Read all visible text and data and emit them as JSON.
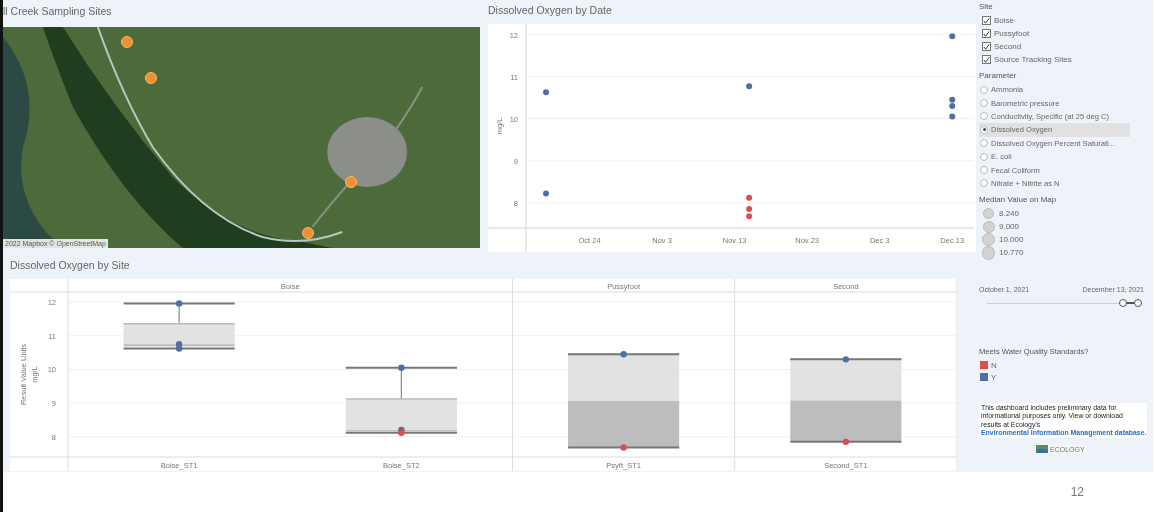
{
  "map": {
    "title": "ll Creek Sampling Sites",
    "attribution": "2022 Mapbox © OpenStreetMap"
  },
  "date_chart": {
    "title": "Dissolved Oxygen by Date",
    "chart_data": {
      "type": "scatter",
      "ylabel": "mg/L",
      "grid": true,
      "x": [
        "2021-10-18",
        "2021-10-18",
        "2021-11-15",
        "2021-11-15",
        "2021-11-15",
        "2021-11-15",
        "2021-12-13",
        "2021-12-13",
        "2021-12-13",
        "2021-12-13"
      ],
      "series": [
        {
          "color": "#4e6fa3",
          "values": [
            10.63,
            8.22,
            10.77,
            null,
            null,
            null,
            11.96,
            10.45,
            10.3,
            10.05
          ]
        },
        {
          "color": "#e04b4b",
          "values": [
            null,
            null,
            null,
            8.12,
            7.85,
            7.68,
            null,
            null,
            null,
            null
          ]
        }
      ],
      "xlim": [
        "2021-10-10",
        "2021-12-16"
      ],
      "ylim": [
        6.83,
        12.25
      ],
      "xticks": [
        {
          "value": "2021-10-24",
          "label": "Oct 24"
        },
        {
          "value": "2021-11-03",
          "label": "Nov 3"
        },
        {
          "value": "2021-11-13",
          "label": "Nov 13"
        },
        {
          "value": "2021-11-23",
          "label": "Nov 23"
        },
        {
          "value": "2021-12-03",
          "label": "Dec 3"
        },
        {
          "value": "2021-12-13",
          "label": "Dec 13"
        }
      ],
      "yticks": [
        8,
        9,
        10,
        11,
        12
      ]
    }
  },
  "site_chart": {
    "title": "Dissolved Oxygen by Site",
    "y_unit": "mg/L",
    "panes": [
      "Boise",
      "Pussyfoot",
      "Second"
    ],
    "chart_data": {
      "type": "scatter",
      "ylabel": "Result Value Units",
      "grid": true,
      "categories": [
        "Boise_ST1",
        "Boise_ST2",
        "Psyft_ST1",
        "Second_ST1"
      ],
      "series": [
        {
          "color": "#4e6fa3",
          "values": [
            11.96,
            10.05,
            10.45,
            10.3
          ]
        },
        {
          "color": "#4e6fa3",
          "values": [
            10.75,
            8.2,
            null,
            null
          ]
        },
        {
          "color": "#4e6fa3",
          "values": [
            10.62,
            null,
            null,
            null
          ]
        },
        {
          "color": "#e04b4b",
          "values": [
            null,
            8.12,
            7.68,
            7.85
          ]
        }
      ],
      "ylim": [
        7.4,
        12.3
      ],
      "yticks": [
        8,
        9,
        10,
        11,
        12
      ]
    }
  },
  "filters": {
    "site": {
      "title": "Site",
      "items": [
        {
          "label": "Boise",
          "checked": true
        },
        {
          "label": "Pussyfoot",
          "checked": true
        },
        {
          "label": "Second",
          "checked": true
        },
        {
          "label": "Source Tracking Sites",
          "checked": true
        }
      ]
    },
    "parameter": {
      "title": "Parameter",
      "items": [
        {
          "label": "Ammonia",
          "selected": false
        },
        {
          "label": "Barometric pressure",
          "selected": false
        },
        {
          "label": "Conductivity, Specific (at 25 deg C)",
          "selected": false
        },
        {
          "label": "Dissolved Oxygen",
          "selected": true
        },
        {
          "label": "Dissolved Oxygen Percent Saturati...",
          "selected": false
        },
        {
          "label": "E. coli",
          "selected": false
        },
        {
          "label": "Fecal Coliform",
          "selected": false
        },
        {
          "label": "Nitrate + Nitrite as N",
          "selected": false
        }
      ]
    },
    "size_legend": {
      "title": "Median Value on Map",
      "items": [
        "8.240",
        "9.000",
        "10.000",
        "10.770"
      ]
    },
    "date_range": {
      "start": "October 1, 2021",
      "end": "December 13, 2021",
      "handles": [
        {
          "level": 0.9
        },
        {
          "level": 1
        }
      ]
    },
    "color_legend": {
      "title": "Meets Water Quality Standards?",
      "items": [
        {
          "label": "N",
          "color": "#e04b4b"
        },
        {
          "label": "Y",
          "color": "#4e6fa3"
        }
      ]
    },
    "note": {
      "text": "This dashboard includes preliminary data for informational purposes only. View or download results at Ecology's",
      "link": "Environmental Information Management database."
    },
    "logo": {
      "text": "ECOLOGY"
    }
  },
  "page_number": "12"
}
